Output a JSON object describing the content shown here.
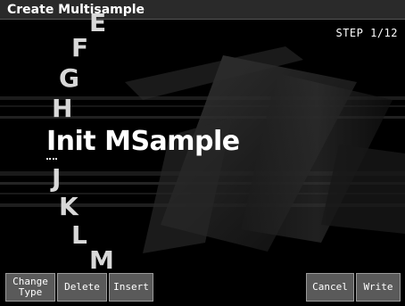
{
  "title": "Create Multisample",
  "step": "STEP 1/12",
  "wheel": {
    "above": [
      "E",
      "F",
      "G",
      "H"
    ],
    "selected": "Init MSample",
    "below": [
      "J",
      "K",
      "L",
      "M"
    ]
  },
  "function_keys": {
    "change_type": "Change\nType",
    "delete": "Delete",
    "insert": "Insert",
    "cancel": "Cancel",
    "write": "Write"
  }
}
